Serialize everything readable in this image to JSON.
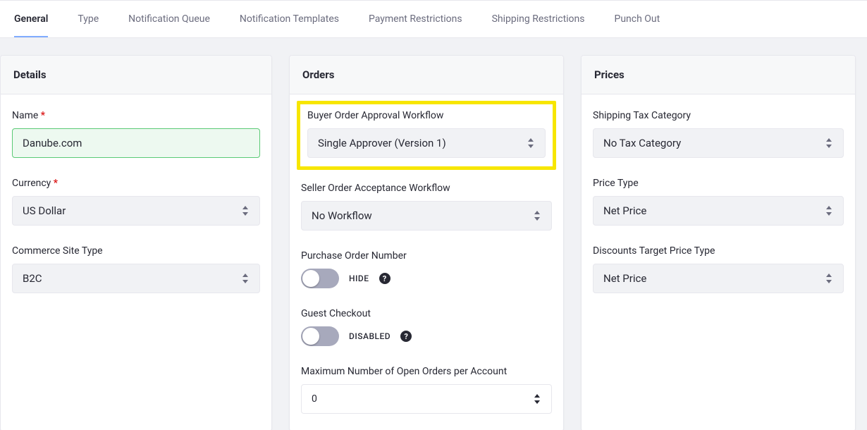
{
  "tabs": [
    "General",
    "Type",
    "Notification Queue",
    "Notification Templates",
    "Payment Restrictions",
    "Shipping Restrictions",
    "Punch Out"
  ],
  "active_tab": 0,
  "details": {
    "title": "Details",
    "name_label": "Name",
    "name_value": "Danube.com",
    "currency_label": "Currency",
    "currency_value": "US Dollar",
    "site_type_label": "Commerce Site Type",
    "site_type_value": "B2C"
  },
  "orders": {
    "title": "Orders",
    "buyer_wf_label": "Buyer Order Approval Workflow",
    "buyer_wf_value": "Single Approver (Version 1)",
    "seller_wf_label": "Seller Order Acceptance Workflow",
    "seller_wf_value": "No Workflow",
    "po_label": "Purchase Order Number",
    "po_state": "HIDE",
    "guest_label": "Guest Checkout",
    "guest_state": "DISABLED",
    "max_open_label": "Maximum Number of Open Orders per Account",
    "max_open_value": "0"
  },
  "prices": {
    "title": "Prices",
    "ship_tax_label": "Shipping Tax Category",
    "ship_tax_value": "No Tax Category",
    "price_type_label": "Price Type",
    "price_type_value": "Net Price",
    "disc_target_label": "Discounts Target Price Type",
    "disc_target_value": "Net Price"
  }
}
